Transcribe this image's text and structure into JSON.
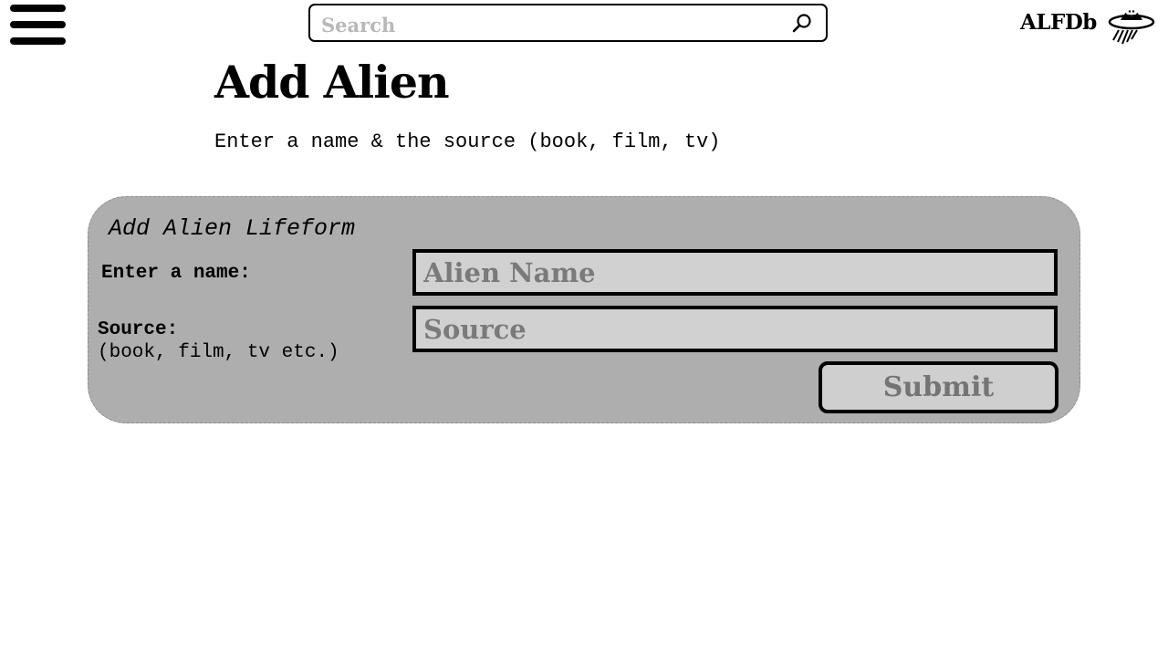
{
  "header": {
    "search": {
      "placeholder": "Search",
      "value": ""
    },
    "brand": "ALFDb",
    "icons": {
      "menu": "hamburger-menu-icon",
      "search": "search-icon",
      "logo": "alien-ufo-logo-icon"
    }
  },
  "page": {
    "title": "Add Alien",
    "subtitle": "Enter a name & the source (book, film, tv)"
  },
  "form": {
    "title": "Add Alien Lifeform",
    "name_label": "Enter a name:",
    "name_placeholder": "Alien Name",
    "name_value": "",
    "source_label": "Source:",
    "source_hint": "(book, film, tv etc.)",
    "source_placeholder": "Source",
    "source_value": "",
    "submit_label": "Submit"
  },
  "colors": {
    "panel_background": "#aeaeae",
    "field_background": "#d1d1d1",
    "button_background": "#cfcfcf",
    "placeholder_text": "#7a7a7a"
  }
}
